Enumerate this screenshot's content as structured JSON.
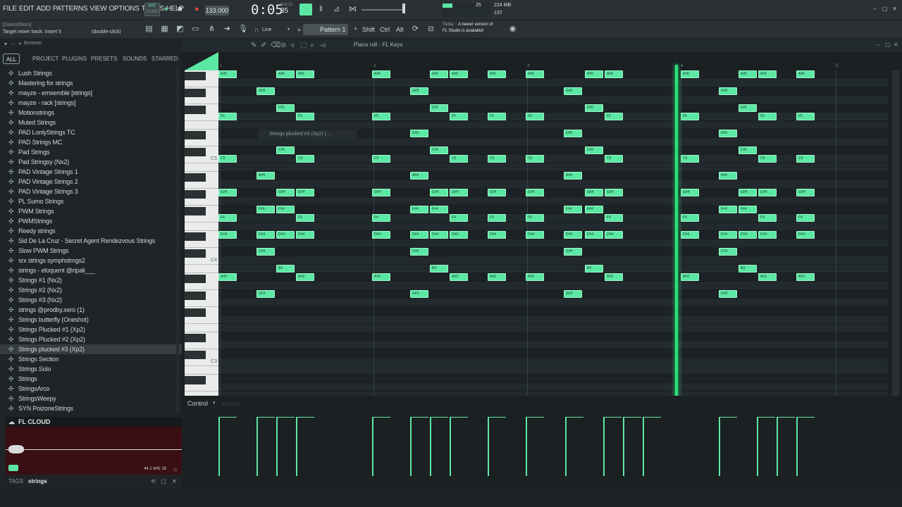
{
  "menu": [
    "FILE",
    "EDIT",
    "ADD",
    "PATTERNS",
    "VIEW",
    "OPTIONS",
    "TOOLS",
    "HELP"
  ],
  "transport": {
    "mode_top": "PAT",
    "mode_bottom": "SONG",
    "tempo": "133.000",
    "time": "0:05",
    "time_sub": "35",
    "time_unit": "M:S:CS",
    "cpu": "25",
    "ram": "224 MB",
    "voices": "137"
  },
  "status": {
    "user": "[GavinDixon]",
    "hint": "Target mixer track: Insert 5",
    "action": "(double-click)"
  },
  "toolbar": {
    "snap": "Line",
    "pattern": "Pattern 1",
    "shift": "Shift",
    "ctrl": "Ctrl",
    "alt": "Alt",
    "news_today": "Today",
    "news_text": "A newer version of",
    "news_text2": "FL Studio is available!"
  },
  "browser": {
    "title": "Browser",
    "tabs": [
      "ALL",
      "PROJECT",
      "PLUGINS",
      "PRESETS",
      "SOUNDS",
      "STARRED"
    ],
    "items": [
      "Lush Strings",
      "Mastering for strings",
      "mayze - emsemble [strings]",
      "mayze - rack [strings]",
      "Motionstrings",
      "Muted Strings",
      "PAD LonlyStrings TC",
      "PAD Strings MC",
      "Pad Strings",
      "Pad Stringsy (Nx2)",
      "PAD Vintage Strings 1",
      "PAD Vintage Strings 2",
      "PAD Vintage Strings 3",
      "PL Sumo Strings",
      "PWM Strings",
      "PWMStrings",
      "Reedy strings",
      "Sid De La Cruz - Secret Agent Rendezvous Strings",
      "Slow PWM Strings",
      "srx strings symphstrngs2",
      "strings - eloquent @ripali___",
      "Strings #1 (Nx2)",
      "Strings #2 (Nx2)",
      "Strings #3 (Nx2)",
      "strings @prodby.xero (1)",
      "Strings butterfly (Oneshot)",
      "Strings Plucked #1 (Xp2)",
      "Strings Plucked #2 (Xp2)",
      "Strings plucked #3 (Xp2)",
      "Strings Section",
      "Strings Solo",
      "Strings",
      "StringsArco",
      "StringsWeepy",
      "SYN PoizoneStrings"
    ],
    "selected_index": 28,
    "cloud": "FL CLOUD",
    "sample_info": "44.1 kHz 16",
    "tags_label": "TAGS",
    "tags_value": "strings"
  },
  "pianoroll": {
    "title": "Piano roll - FL Keys",
    "tooltip": "Strings plucked #3 (Xp2) (...",
    "control": "Control",
    "control_sub": "Velocity",
    "octave_labels": [
      "C5",
      "C4",
      "C3"
    ],
    "bar_numbers": [
      "1",
      "2",
      "3",
      "4",
      "5"
    ]
  },
  "notes_rows": [
    {
      "label": "A#5",
      "row": 0
    },
    {
      "label": "G#5",
      "row": 2
    },
    {
      "label": "F#5",
      "row": 4
    },
    {
      "label": "F5",
      "row": 5
    },
    {
      "label": "D#5",
      "row": 7
    },
    {
      "label": "C#5",
      "row": 9
    },
    {
      "label": "C5",
      "row": 10
    },
    {
      "label": "A#4",
      "row": 12
    },
    {
      "label": "G#4",
      "row": 14
    },
    {
      "label": "F#4",
      "row": 16
    },
    {
      "label": "F4",
      "row": 17
    },
    {
      "label": "D#4",
      "row": 19
    },
    {
      "label": "C#4",
      "row": 21
    },
    {
      "label": "B3",
      "row": 23
    },
    {
      "label": "A#3",
      "row": 24
    },
    {
      "label": "G#3",
      "row": 26
    }
  ],
  "colors": {
    "accent": "#5be8a4",
    "playhead": "#2de07a",
    "bg": "#1f2528"
  }
}
